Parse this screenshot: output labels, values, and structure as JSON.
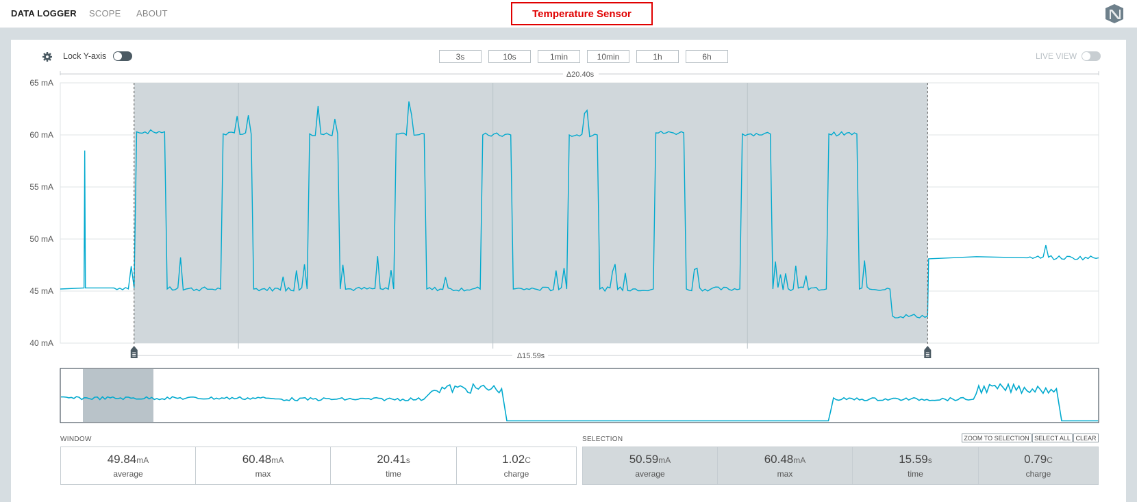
{
  "nav": {
    "items": [
      "DATA LOGGER",
      "SCOPE",
      "ABOUT"
    ],
    "title_box": "Temperature Sensor"
  },
  "controls": {
    "lock_label": "Lock Y-axis",
    "live_label": "LIVE VIEW",
    "ranges": [
      "3s",
      "10s",
      "1min",
      "10min",
      "1h",
      "6h"
    ]
  },
  "chart": {
    "window_delta": "Δ20.40s",
    "selection_delta": "Δ15.59s",
    "y_ticks": [
      "65 mA",
      "60 mA",
      "55 mA",
      "50 mA",
      "45 mA",
      "40 mA"
    ]
  },
  "chart_data": {
    "type": "line",
    "unit": "mA",
    "ylim": [
      40,
      65
    ],
    "xlim": [
      0,
      20.4
    ],
    "selection": [
      1.45,
      17.04
    ],
    "series": [
      {
        "color": "#00a9ce",
        "x": [
          0,
          1.0,
          1.45,
          1.5,
          2.05,
          2.1,
          3.15,
          3.2,
          3.75,
          3.8,
          4.85,
          4.9,
          5.45,
          5.5,
          6.55,
          6.6,
          7.15,
          7.2,
          8.25,
          8.3,
          8.85,
          8.9,
          9.95,
          10.0,
          10.55,
          10.6,
          11.65,
          11.7,
          12.25,
          12.3,
          13.35,
          13.4,
          13.95,
          14.0,
          15.05,
          15.1,
          15.65,
          15.7,
          16.3,
          16.35,
          17.04,
          17.06,
          18.0,
          19.0,
          20.4
        ],
        "y": [
          45.2,
          45.3,
          45.3,
          60.3,
          60.3,
          45.2,
          45.2,
          60.1,
          60.1,
          45.2,
          45.2,
          60.1,
          60.1,
          45.2,
          45.2,
          60.1,
          60.1,
          45.2,
          45.2,
          60.0,
          60.0,
          45.2,
          45.2,
          60.0,
          60.0,
          45.2,
          45.2,
          60.2,
          60.2,
          45.2,
          45.2,
          60.1,
          60.1,
          45.2,
          45.2,
          60.1,
          60.1,
          45.2,
          45.2,
          42.6,
          42.6,
          48.1,
          48.3,
          48.2,
          48.2
        ]
      }
    ]
  },
  "stats": {
    "window_label": "WINDOW",
    "selection_label": "SELECTION",
    "window": [
      {
        "value": "49.84",
        "unit": "mA",
        "caption": "average"
      },
      {
        "value": "60.48",
        "unit": "mA",
        "caption": "max"
      },
      {
        "value": "20.41",
        "unit": "s",
        "caption": "time"
      },
      {
        "value": "1.02",
        "unit": "C",
        "caption": "charge"
      }
    ],
    "selection": [
      {
        "value": "50.59",
        "unit": "mA",
        "caption": "average"
      },
      {
        "value": "60.48",
        "unit": "mA",
        "caption": "max"
      },
      {
        "value": "15.59",
        "unit": "s",
        "caption": "time"
      },
      {
        "value": "0.79",
        "unit": "C",
        "caption": "charge"
      }
    ],
    "buttons": [
      "ZOOM TO SELECTION",
      "SELECT ALL",
      "CLEAR"
    ]
  },
  "colors": {
    "trace": "#00a9ce",
    "selection_fill": "#d0d7db",
    "title_border": "#e00000"
  },
  "icons": [
    "gear-icon",
    "logo-icon",
    "handle-icon"
  ]
}
